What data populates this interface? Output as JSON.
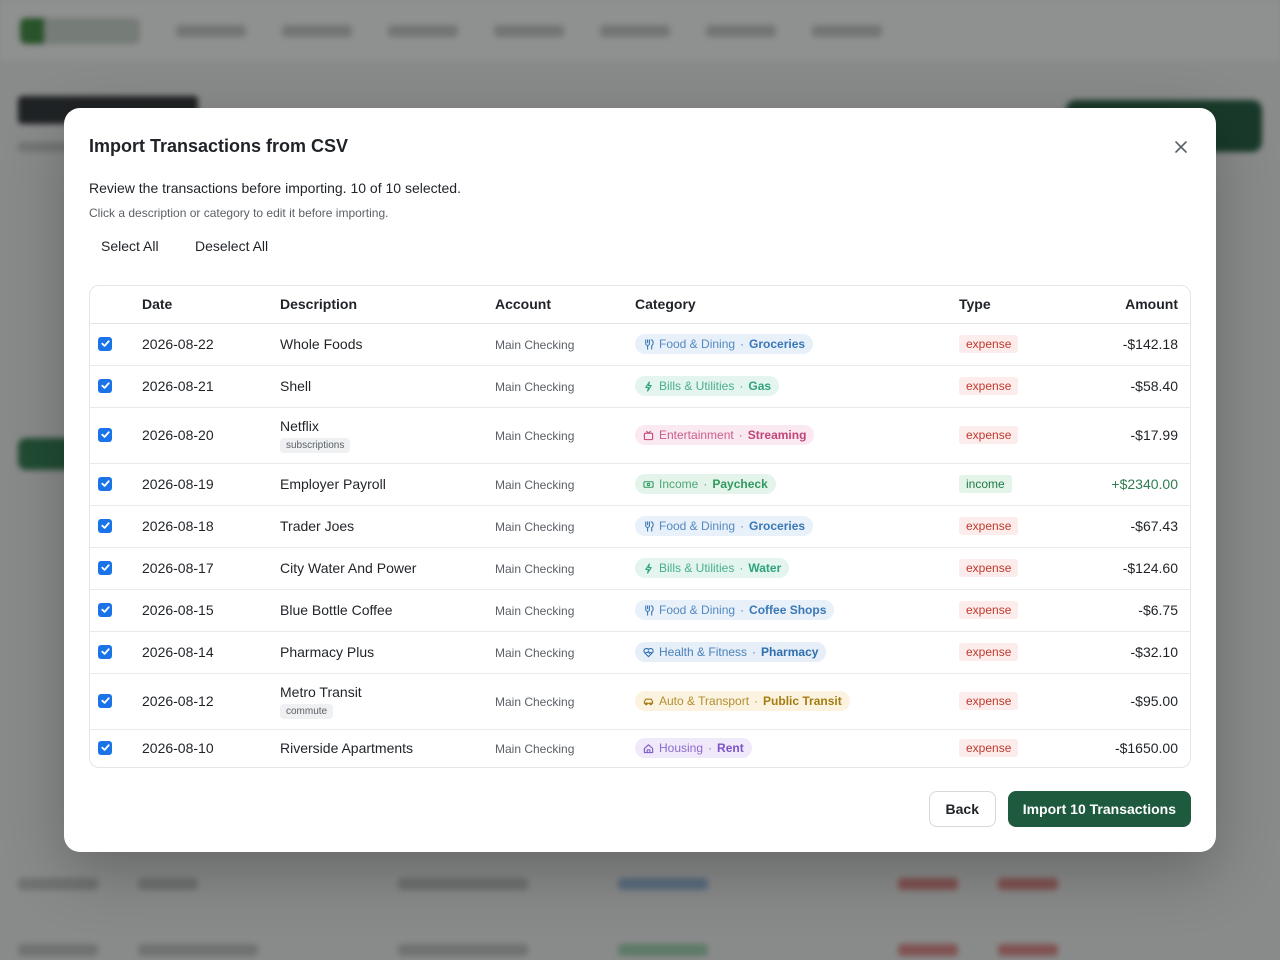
{
  "modal": {
    "title": "Import Transactions from CSV",
    "review_text": "Review the transactions before importing. 10 of 10 selected.",
    "hint_text": "Click a description or category to edit it before importing.",
    "select_all_label": "Select All",
    "deselect_all_label": "Deselect All",
    "back_label": "Back",
    "import_label": "Import 10 Transactions"
  },
  "table": {
    "headers": {
      "date": "Date",
      "description": "Description",
      "account": "Account",
      "category": "Category",
      "type": "Type",
      "amount": "Amount"
    },
    "rows": [
      {
        "checked": true,
        "date": "2026-08-22",
        "description": "Whole Foods",
        "tag": "",
        "account": "Main Checking",
        "cat": "Food & Dining",
        "sub": "Groceries",
        "icon": "utensils-icon",
        "type": "expense",
        "amount": "-$142.18"
      },
      {
        "checked": true,
        "date": "2026-08-21",
        "description": "Shell",
        "tag": "",
        "account": "Main Checking",
        "cat": "Bills & Utilities",
        "sub": "Gas",
        "icon": "bolt-icon",
        "type": "expense",
        "amount": "-$58.40"
      },
      {
        "checked": true,
        "date": "2026-08-20",
        "description": "Netflix",
        "tag": "subscriptions",
        "account": "Main Checking",
        "cat": "Entertainment",
        "sub": "Streaming",
        "icon": "tv-icon",
        "type": "expense",
        "amount": "-$17.99"
      },
      {
        "checked": true,
        "date": "2026-08-19",
        "description": "Employer Payroll",
        "tag": "",
        "account": "Main Checking",
        "cat": "Income",
        "sub": "Paycheck",
        "icon": "banknote-icon",
        "type": "income",
        "amount": "+$2340.00"
      },
      {
        "checked": true,
        "date": "2026-08-18",
        "description": "Trader Joes",
        "tag": "",
        "account": "Main Checking",
        "cat": "Food & Dining",
        "sub": "Groceries",
        "icon": "utensils-icon",
        "type": "expense",
        "amount": "-$67.43"
      },
      {
        "checked": true,
        "date": "2026-08-17",
        "description": "City Water And Power",
        "tag": "",
        "account": "Main Checking",
        "cat": "Bills & Utilities",
        "sub": "Water",
        "icon": "bolt-icon",
        "type": "expense",
        "amount": "-$124.60"
      },
      {
        "checked": true,
        "date": "2026-08-15",
        "description": "Blue Bottle Coffee",
        "tag": "",
        "account": "Main Checking",
        "cat": "Food & Dining",
        "sub": "Coffee Shops",
        "icon": "utensils-icon",
        "type": "expense",
        "amount": "-$6.75"
      },
      {
        "checked": true,
        "date": "2026-08-14",
        "description": "Pharmacy Plus",
        "tag": "",
        "account": "Main Checking",
        "cat": "Health & Fitness",
        "sub": "Pharmacy",
        "icon": "heart-pulse-icon",
        "type": "expense",
        "amount": "-$32.10"
      },
      {
        "checked": true,
        "date": "2026-08-12",
        "description": "Metro Transit",
        "tag": "commute",
        "account": "Main Checking",
        "cat": "Auto & Transport",
        "sub": "Public Transit",
        "icon": "car-icon",
        "type": "expense",
        "amount": "-$95.00"
      },
      {
        "checked": true,
        "date": "2026-08-10",
        "description": "Riverside Apartments",
        "tag": "",
        "account": "Main Checking",
        "cat": "Housing",
        "sub": "Rent",
        "icon": "home-icon",
        "type": "expense",
        "amount": "-$1650.00"
      }
    ]
  },
  "colors": {
    "primary": "#1e5a3d",
    "checkbox": "#1a73e8",
    "expense_text": "#c0392b",
    "income_text": "#1f7a45",
    "cat_food": "#3a78b5",
    "cat_bills": "#2fa37a",
    "cat_entertainment": "#c0457a",
    "cat_income": "#2e9a5e",
    "cat_health": "#2f6fae",
    "cat_transport": "#a57c12",
    "cat_housing": "#7b55c7"
  }
}
